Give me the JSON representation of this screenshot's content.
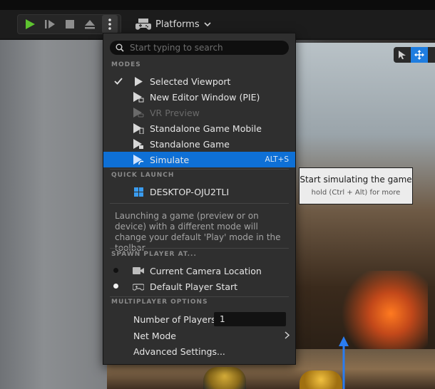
{
  "toolbar": {
    "platforms_label": "Platforms"
  },
  "menu": {
    "search_placeholder": "Start typing to search",
    "sections": {
      "modes": "MODES",
      "quick_launch": "QUICK LAUNCH",
      "spawn": "SPAWN PLAYER AT...",
      "multiplayer": "MULTIPLAYER OPTIONS"
    },
    "modes": [
      {
        "label": "Selected Viewport",
        "checked": true
      },
      {
        "label": "New Editor Window (PIE)"
      },
      {
        "label": "VR Preview",
        "disabled": true
      },
      {
        "label": "Standalone Game Mobile"
      },
      {
        "label": "Standalone Game"
      },
      {
        "label": "Simulate",
        "shortcut": "ALT+S",
        "highlighted": true
      }
    ],
    "quick_launch": [
      {
        "label": "DESKTOP-OJU2TLI"
      }
    ],
    "info_text": "Launching a game (preview or on device) with a different mode will change your default 'Play' mode in the toolbar",
    "spawn": [
      {
        "label": "Current Camera Location",
        "selected": false
      },
      {
        "label": "Default Player Start",
        "selected": true
      }
    ],
    "multiplayer": {
      "players_label": "Number of Players",
      "players_value": "1",
      "net_mode_label": "Net Mode",
      "advanced_label": "Advanced Settings..."
    }
  },
  "tooltip": {
    "title": "Start simulating the game",
    "hint": "hold (Ctrl + Alt) for more"
  },
  "colors": {
    "accent": "#0e70d6",
    "play_green": "#5ec430",
    "menu_bg": "#2f2f2f"
  }
}
